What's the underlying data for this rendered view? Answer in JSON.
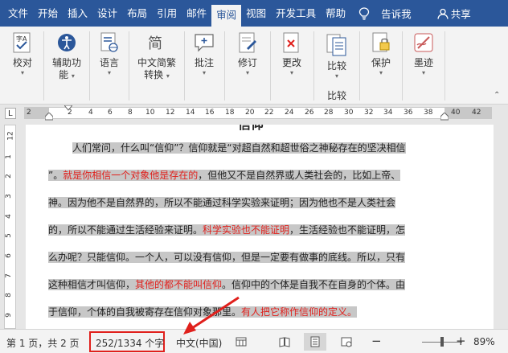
{
  "tabs": [
    "文件",
    "开始",
    "插入",
    "设计",
    "布局",
    "引用",
    "邮件",
    "审阅",
    "视图",
    "开发工具",
    "帮助"
  ],
  "active_tab": "审阅",
  "tell_me": "告诉我",
  "share": "共享",
  "ribbon": {
    "proofing": "校对",
    "accessibility_1": "辅助功",
    "accessibility_2": "能",
    "language": "语言",
    "chinese_convert_1": "中文简繁",
    "chinese_convert_2": "转换",
    "comments": "批注",
    "tracking": "修订",
    "changes": "更改",
    "compare": "比较",
    "compare_group": "比较",
    "protect": "保护",
    "ink": "墨迹"
  },
  "ruler": {
    "numbers": [
      "2",
      "2",
      "4",
      "6",
      "8",
      "10",
      "12",
      "14",
      "16",
      "18",
      "20",
      "22",
      "24",
      "26",
      "28",
      "30",
      "32",
      "34",
      "36",
      "38",
      "40",
      "42"
    ]
  },
  "vruler": {
    "numbers": [
      "12",
      "1",
      "2",
      "3",
      "4",
      "5",
      "6",
      "7",
      "8",
      "9"
    ]
  },
  "document": {
    "heading_fragment": "信仰",
    "lines": [
      {
        "segments": [
          {
            "text": "人们常问，什么叫“信仰”？信仰就是“对超自然和超世俗之神秘存在的坚决相信",
            "red": false
          }
        ]
      },
      {
        "segments": [
          {
            "text": "”。",
            "red": false
          },
          {
            "text": "就是你相信一个对象他是存在的",
            "red": true
          },
          {
            "text": "，但他又不是自然界或人类社会的，比如上帝、",
            "red": false
          }
        ]
      },
      {
        "segments": [
          {
            "text": "神。因为他不是自然界的，所以不能通过科学实验来证明；因为他也不是人类社会",
            "red": false
          }
        ]
      },
      {
        "segments": [
          {
            "text": "的，所以不能通过生活经验来证明。",
            "red": false
          },
          {
            "text": "科学实验也不能证明",
            "red": true
          },
          {
            "text": "，生活经验也不能证明，怎",
            "red": false
          }
        ]
      },
      {
        "segments": [
          {
            "text": "么办呢？只能信仰。一个人，可以没有信仰，但是一定要有做事的底线。所以，只有",
            "red": false
          }
        ]
      },
      {
        "segments": [
          {
            "text": "这种相信才叫信仰，",
            "red": false
          },
          {
            "text": "其他的都不能叫信仰",
            "red": true
          },
          {
            "text": "。信仰中的个体是自我不在自身的个体。由",
            "red": false
          }
        ]
      },
      {
        "segments": [
          {
            "text": "于信仰，个体的自我被寄存在信仰对象那里。",
            "red": false
          },
          {
            "text": "有人把它称作信仰的定义。",
            "red": true
          }
        ]
      }
    ]
  },
  "status": {
    "page": "第 1 页，共 2 页",
    "words": "252/1334 个字",
    "language": "中文(中国)",
    "zoom": "89%",
    "minus": "−",
    "plus": "+"
  },
  "colors": {
    "title_bar": "#2b579a",
    "highlight": "#c7c7c7",
    "red_text": "#e0201c",
    "annotation": "#e0201c"
  }
}
